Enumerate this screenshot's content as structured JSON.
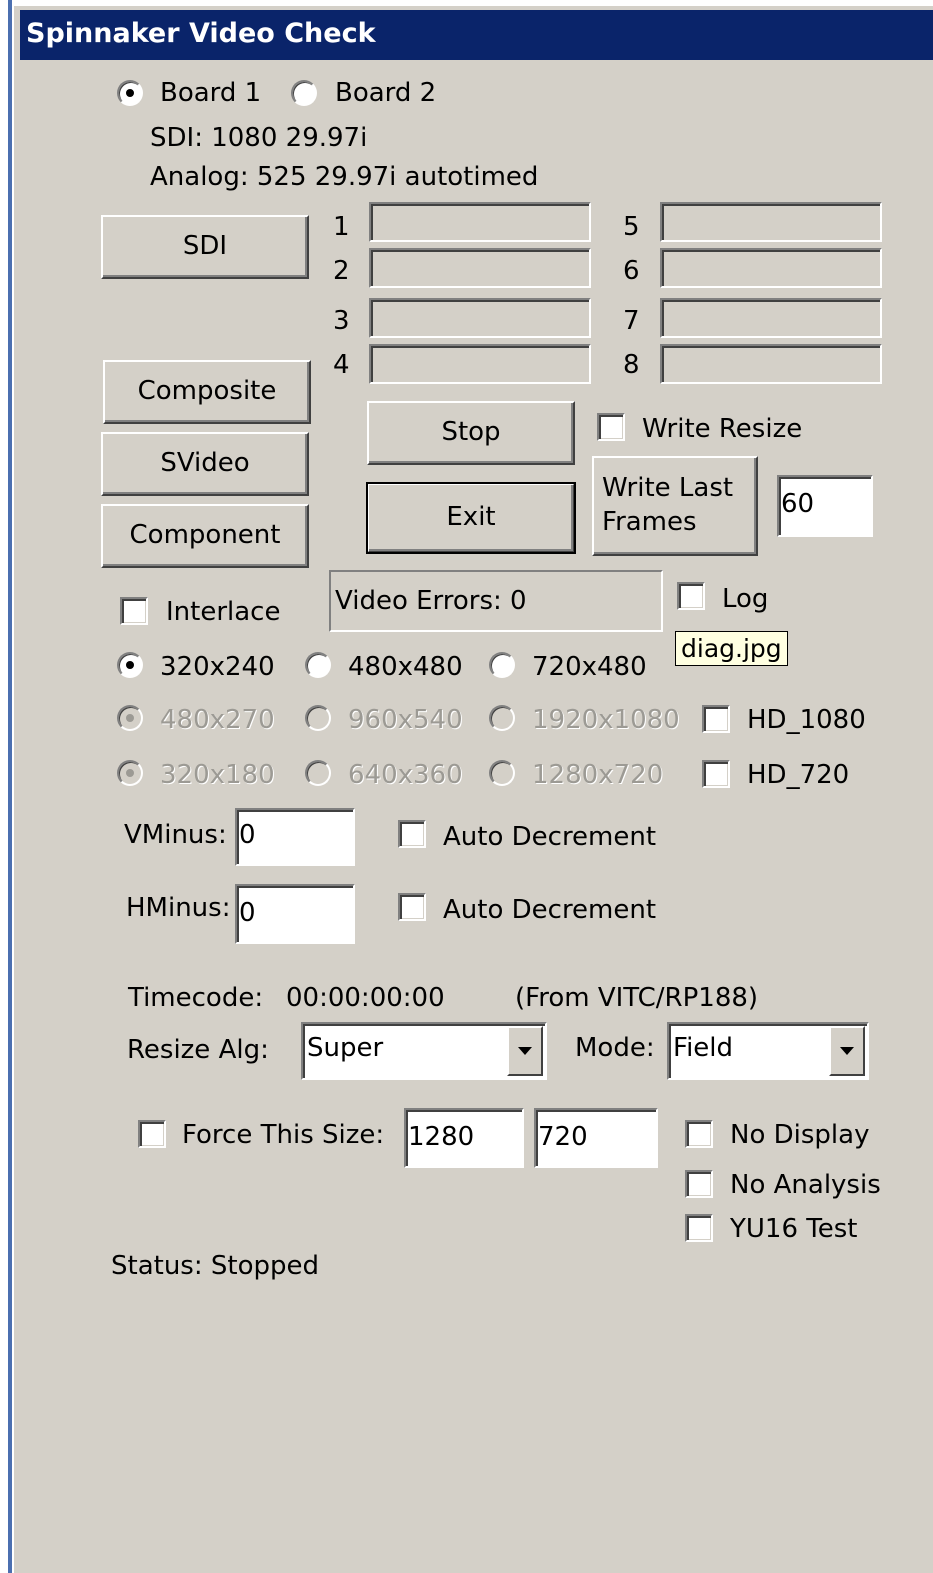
{
  "window": {
    "title": "Spinnaker Video Check"
  },
  "boards": [
    {
      "label": "Board 1",
      "selected": true
    },
    {
      "label": "Board 2",
      "selected": false
    }
  ],
  "info": {
    "sdi": "SDI: 1080 29.97i",
    "analog": "Analog: 525 29.97i autotimed"
  },
  "source_buttons": {
    "sdi": "SDI",
    "composite": "Composite",
    "svideo": "SVideo",
    "component": "Component"
  },
  "channels": [
    {
      "label": "1",
      "value": ""
    },
    {
      "label": "2",
      "value": ""
    },
    {
      "label": "3",
      "value": ""
    },
    {
      "label": "4",
      "value": ""
    },
    {
      "label": "5",
      "value": ""
    },
    {
      "label": "6",
      "value": ""
    },
    {
      "label": "7",
      "value": ""
    },
    {
      "label": "8",
      "value": ""
    }
  ],
  "controls": {
    "stop": "Stop",
    "exit": "Exit",
    "write_resize": "Write Resize",
    "write_last_frames": "Write Last Frames",
    "frames_count": "60",
    "interlace": "Interlace",
    "video_errors": "Video Errors: 0",
    "log": "Log",
    "tooltip": "diag.jpg"
  },
  "sizes": {
    "row1": [
      "320x240",
      "480x480",
      "720x480"
    ],
    "row2": [
      "480x270",
      "960x540",
      "1920x1080"
    ],
    "row3": [
      "320x180",
      "640x360",
      "1280x720"
    ],
    "hd_1080": "HD_1080",
    "hd_720": "HD_720"
  },
  "offsets": {
    "vminus_label": "VMinus:",
    "vminus_value": "0",
    "hminus_label": "HMinus:",
    "hminus_value": "0",
    "auto_decrement": "Auto Decrement"
  },
  "timecode": {
    "label": "Timecode:",
    "value": "00:00:00:00",
    "source": "(From VITC/RP188)"
  },
  "resize": {
    "alg_label": "Resize Alg:",
    "alg_value": "Super",
    "mode_label": "Mode:",
    "mode_value": "Field"
  },
  "force": {
    "label": "Force This Size:",
    "width": "1280",
    "height": "720"
  },
  "options": {
    "no_display": "No Display",
    "no_analysis": "No Analysis",
    "yu16_test": "YU16 Test"
  },
  "status": "Status: Stopped",
  "icons": {
    "dropdown": "chevron-down-icon"
  }
}
